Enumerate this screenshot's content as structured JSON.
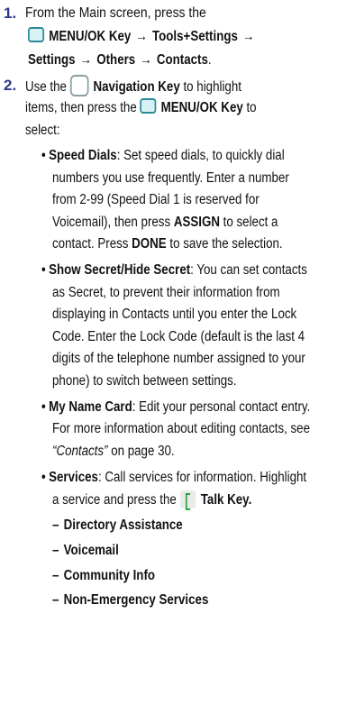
{
  "step1": {
    "number": "1.",
    "line1": "From the Main screen, press the",
    "menu_key": "MENU/OK Key",
    "arrow": "→",
    "tools": "Tools+Settings",
    "settings": "Settings",
    "others": "Others",
    "contacts": "Contacts",
    "period": "."
  },
  "step2": {
    "number": "2.",
    "use_the": "Use the",
    "nav_key": "Navigation Key",
    "to_highlight": "to highlight",
    "items_then": "items, then press the",
    "menu_key": "MENU/OK Key",
    "to": "to",
    "select": "select:"
  },
  "bullets": {
    "speed_dials": {
      "title": "Speed Dials",
      "l1": ": Set speed dials, to quickly dial",
      "l2": "numbers you use frequently. Enter a number",
      "l3": "from 2-99 (Speed Dial 1 is reserved for",
      "l4a": "Voicemail), then press ",
      "assign": "ASSIGN",
      "l4b": " to select a",
      "l5a": "contact. Press ",
      "done": "DONE",
      "l5b": " to save the selection."
    },
    "secret": {
      "title": "Show Secret/Hide Secret",
      "l1": ": You can set contacts",
      "l2": "as Secret, to prevent their information from",
      "l3": "displaying in Contacts until you enter the Lock",
      "l4": "Code. Enter the Lock Code (default is the last 4",
      "l5": "digits of the telephone number assigned to your",
      "l6": "phone) to switch between settings."
    },
    "name_card": {
      "title": "My Name Card",
      "l1": ": Edit your personal contact entry.",
      "l2": "For more information about editing contacts, see",
      "ref": "“Contacts”",
      "page": " on page 30."
    },
    "services": {
      "title": "Services",
      "l1": ": Call services for information. Highlight",
      "l2": "a service and press the",
      "talk_key": "Talk Key.",
      "items": [
        "Directory Assistance",
        "Voicemail",
        "Community Info",
        "Non-Emergency Services"
      ],
      "dash": "–"
    }
  }
}
